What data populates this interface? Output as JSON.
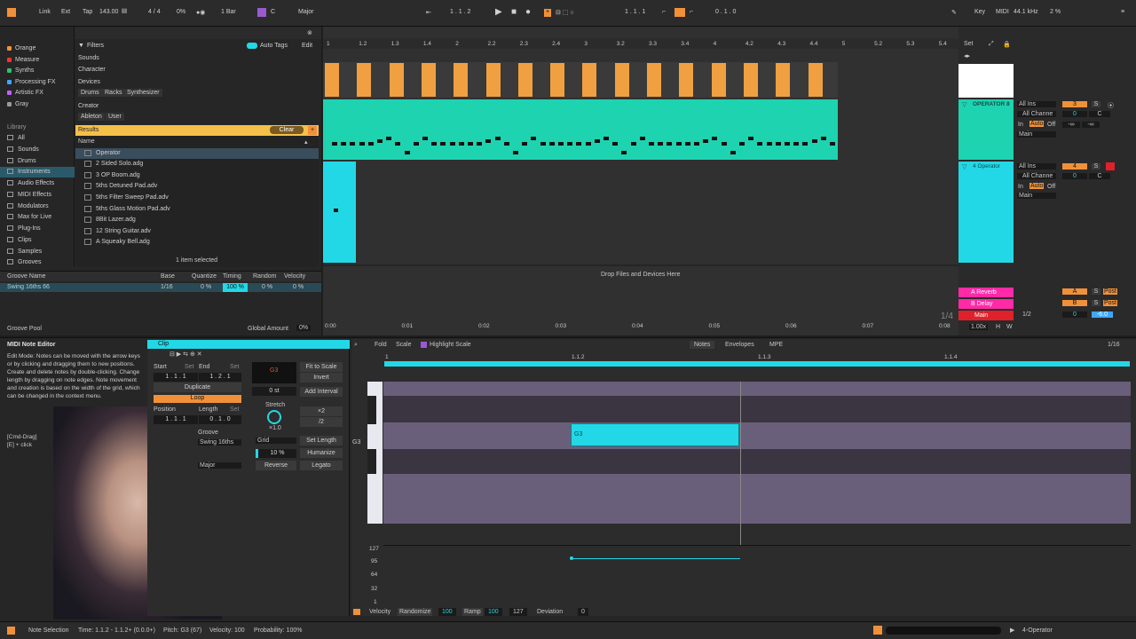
{
  "transport": {
    "link": "Link",
    "ext": "Ext",
    "tap": "Tap",
    "tempo": "143.00",
    "meter": "4 / 4",
    "cpu_pct": "0%",
    "quant": "1 Bar",
    "key_root": "C",
    "scale": "Major",
    "position": "1 . 1 . 2",
    "loop_start": "1 . 1 . 1",
    "loop_len": "0 . 1 . 0",
    "key": "Key",
    "midi": "MIDI",
    "sample_rate": "44.1 kHz",
    "cpu_load": "2 %"
  },
  "colors": {
    "accent_orange": "#f0913a",
    "teal": "#1dd3b0",
    "cyan": "#22d8e6",
    "pink": "#ff2aa6",
    "red": "#e0202a",
    "purple_lane": "#6a5f7a"
  },
  "sidebar": {
    "collections": [
      {
        "label": "Orange",
        "color": "#f0913a"
      },
      {
        "label": "Measure",
        "color": "#ff3030"
      },
      {
        "label": "Synths",
        "color": "#2bc26a"
      },
      {
        "label": "Processing FX",
        "color": "#3fa6ff"
      },
      {
        "label": "Artistic FX",
        "color": "#c060ff"
      },
      {
        "label": "Gray",
        "color": "#9a9a9a"
      }
    ],
    "library_header": "Library",
    "library": [
      "All",
      "Sounds",
      "Drums",
      "Instruments",
      "Audio Effects",
      "MIDI Effects",
      "Modulators",
      "Max for Live",
      "Plug-Ins",
      "Clips",
      "Samples",
      "Grooves"
    ],
    "search": "operat"
  },
  "filters": {
    "title": "Filters",
    "auto_tags": "Auto Tags",
    "edit": "Edit",
    "sounds": "Sounds",
    "character": "Character",
    "devices": "Devices",
    "device_tags": [
      "Drums",
      "Racks",
      "Synthesizer"
    ],
    "creator": "Creator",
    "creator_tags": [
      "Ableton",
      "User"
    ]
  },
  "results": {
    "title": "Results",
    "clear": "Clear",
    "name_col": "Name",
    "items": [
      "Operator",
      "2 Sided Solo.adg",
      "3 OP Boom.adg",
      "5ths Detuned Pad.adv",
      "5ths Filter Sweep Pad.adv",
      "5ths Glass Motion Pad.adv",
      "8Bit Lazer.adg",
      "12 String Guitar.adv",
      "A Squeaky Bell.adg"
    ],
    "status": "1 item selected"
  },
  "groove": {
    "cols": [
      "Groove Name",
      "Base",
      "Quantize",
      "Timing",
      "Random",
      "Velocity"
    ],
    "row": {
      "name": "Swing 16ths 66",
      "base": "1/16",
      "quantize": "0 %",
      "timing": "100 %",
      "random": "0 %",
      "velocity": "0 %"
    },
    "pool": "Groove Pool",
    "global_amount_label": "Global Amount",
    "global_amount": "0%"
  },
  "arrangement": {
    "ticks": [
      "1",
      "1.2",
      "1.3",
      "1.4",
      "2",
      "2.2",
      "2.3",
      "2.4",
      "3",
      "3.2",
      "3.3",
      "3.4",
      "4",
      "4.2",
      "4.3",
      "4.4",
      "5",
      "5.2",
      "5.3",
      "5.4"
    ],
    "drop_text": "Drop Files and Devices Here",
    "time_ticks": [
      "0:00",
      "0:01",
      "0:02",
      "0:03",
      "0:04",
      "0:05",
      "0:06",
      "0:07",
      "0:08"
    ],
    "zoom": "1/4",
    "set": "Set"
  },
  "mixer": {
    "tracks": [
      {
        "name": "OPERATOR 8",
        "input": "All Ins",
        "channel": "All Channe",
        "num": "3",
        "output": "Main",
        "color": "#1dd3b0"
      },
      {
        "name": "4 Operator",
        "input": "All Ins",
        "channel": "All Channe",
        "num": "4",
        "output": "Main",
        "color": "#22d8e6"
      }
    ],
    "returns": [
      {
        "name": "A Reverb",
        "letter": "A",
        "color": "#ff2aa6"
      },
      {
        "name": "B Delay",
        "letter": "B",
        "color": "#ff2aa6"
      }
    ],
    "main": {
      "name": "Main",
      "quant": "1/2",
      "vol": "0",
      "pan": "-6.0",
      "color": "#e0202a"
    },
    "sends": "S",
    "post": "Post",
    "in": "In",
    "auto": "Auto",
    "off": "Off",
    "c": "C",
    "zero": "0",
    "inf": "-∞",
    "tempo_scale": "1.00x",
    "h": "H",
    "w": "W"
  },
  "info": {
    "title": "MIDI Note Editor",
    "body": "Edit Mode: Notes can be moved with the arrow keys or by clicking and dragging them to new positions. Create and delete notes by double-clicking. Change length by dragging on note edges. Note movement and creation is based on the width of the grid, which can be changed in the context menu.",
    "shortcut1": "[Cmd-Drag]",
    "shortcut2": "[E] + click"
  },
  "clip": {
    "title": "Clip",
    "start": "Start",
    "end": "End",
    "set": "Set",
    "start_val": "1 . 1 . 1",
    "end_val": "1 . 2 . 1",
    "duplicate": "Duplicate",
    "loop": "Loop",
    "position": "Position",
    "length": "Length",
    "pos_val": "1 . 1 . 1",
    "len_val": "0 . 1 . 0",
    "groove": "Groove",
    "groove_val": "Swing 16ths",
    "scale_val": "Major",
    "note": "G3",
    "fit": "Fit to Scale",
    "invert": "Invert",
    "semis": "0 st",
    "add_interval": "Add Interval",
    "stretch": "Stretch",
    "x2": "×2",
    "d2": "/2",
    "stretch_val": "×1.0",
    "grid": "Grid",
    "set_length": "Set Length",
    "pct": "10 %",
    "humanize": "Humanize",
    "reverse": "Reverse",
    "legato": "Legato"
  },
  "editor": {
    "fold": "Fold",
    "scale": "Scale",
    "highlight": "Highlight Scale",
    "tabs": [
      "Notes",
      "Envelopes",
      "MPE"
    ],
    "grid": "1/16",
    "ticks": [
      "1",
      "1.1.2",
      "1.1.3",
      "1.1.4"
    ],
    "note_label": "G3",
    "key_label": "G3",
    "vel_labels": [
      "127",
      "95",
      "64",
      "32",
      "1"
    ],
    "velocity": "Velocity",
    "randomize": "Randomize",
    "rand_val": "100",
    "ramp": "Ramp",
    "ramp_val": "100",
    "ramp_max": "127",
    "deviation": "Deviation",
    "dev_val": "0"
  },
  "status": {
    "mode": "Note Selection",
    "time": "Time: 1.1.2 - 1.1.2+ (0.0.0+)",
    "pitch": "Pitch: G3 (67)",
    "velocity": "Velocity: 100",
    "probability": "Probability: 100%",
    "track": "4-Operator"
  }
}
